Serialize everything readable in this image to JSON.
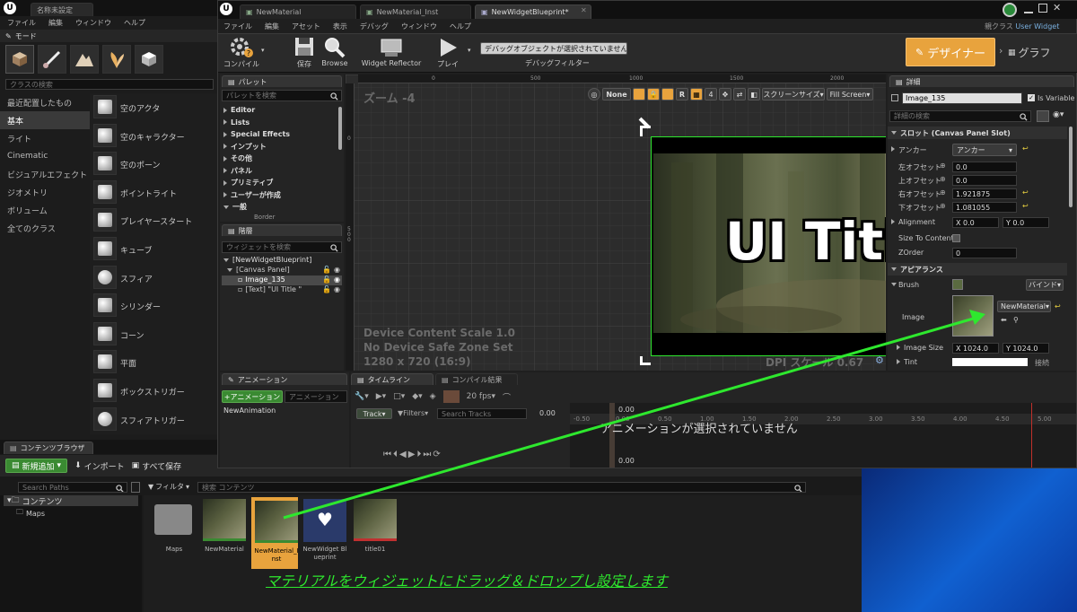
{
  "title_tab": "名称未設定",
  "menu_left": [
    "ファイル",
    "編集",
    "ウィンドウ",
    "ヘルプ"
  ],
  "modes_tab": "モード",
  "class_search_placeholder": "クラスの検索",
  "categories": [
    "最近配置したもの",
    "基本",
    "ライト",
    "Cinematic",
    "ビジュアルエフェクト",
    "ジオメトリ",
    "ボリューム",
    "全てのクラス"
  ],
  "actors": [
    "空のアクタ",
    "空のキャラクター",
    "空のポーン",
    "ポイントライト",
    "プレイヤースタート",
    "キューブ",
    "スフィア",
    "シリンダー",
    "コーン",
    "平面",
    "ボックストリガー",
    "スフィアトリガー"
  ],
  "editor_tabs": [
    "NewMaterial",
    "NewMaterial_Inst",
    "NewWidgetBlueprint*"
  ],
  "parent_class_label": "親クラス",
  "parent_class": "User Widget",
  "menu_editor": [
    "ファイル",
    "編集",
    "アセット",
    "表示",
    "デバッグ",
    "ウィンドウ",
    "ヘルプ"
  ],
  "toolbar": {
    "compile": "コンパイル",
    "save": "保存",
    "browse": "Browse",
    "reflector": "Widget Reflector",
    "play": "プレイ",
    "debug_dropdown": "デバッグオブジェクトが選択されていません",
    "debug_filter": "デバッグフィルター",
    "designer": "デザイナー",
    "graph": "グラフ"
  },
  "palette": {
    "tab": "パレット",
    "search_placeholder": "パレットを検索",
    "items": [
      "Editor",
      "Lists",
      "Special Effects",
      "インプット",
      "その他",
      "パネル",
      "プリミティブ",
      "ユーザーが作成",
      "一般"
    ],
    "sub_item": "Border"
  },
  "hierarchy": {
    "tab": "階層",
    "search_placeholder": "ウィジェットを検索",
    "items": [
      "[NewWidgetBlueprint]",
      "[Canvas Panel]",
      "Image_135",
      "[Text] \"UI Title \""
    ]
  },
  "viewport": {
    "zoom": "ズーム -4",
    "ruler": [
      "0",
      "500",
      "1000",
      "1500",
      "2000"
    ],
    "ruler_v": [
      "0",
      "5 0 0"
    ],
    "none_label": "None",
    "r_label": "R",
    "four_label": "4",
    "screen_size": "スクリーンサイズ",
    "fill_screen": "Fill Screen",
    "ui_title": "UI Title",
    "info1": "Device Content Scale 1.0",
    "info2": "No Device Safe Zone Set",
    "info3": "1280 x 720 (16:9)",
    "dpi": "DPI スケール 0.67"
  },
  "details": {
    "tab": "詳細",
    "name": "Image_135",
    "is_variable": "Is Variable",
    "search_placeholder": "詳細の検索",
    "slot_section": "スロット (Canvas Panel Slot)",
    "anchor_label": "アンカー",
    "anchor_value": "アンカー",
    "offsets": [
      {
        "label": "左オフセット",
        "value": "0.0"
      },
      {
        "label": "上オフセット",
        "value": "0.0"
      },
      {
        "label": "右オフセット",
        "value": "1.921875"
      },
      {
        "label": "下オフセット",
        "value": "1.081055"
      }
    ],
    "alignment_label": "Alignment",
    "align_x": "X  0.0",
    "align_y": "Y  0.0",
    "size_to_content": "Size To Content",
    "zorder_label": "ZOrder",
    "zorder_value": "0",
    "appearance_section": "アピアランス",
    "brush_label": "Brush",
    "bind_label": "バインド",
    "image_label": "Image",
    "image_value": "NewMaterial",
    "image_size_label": "Image Size",
    "size_x": "X  1024.0",
    "size_y": "Y  1024.0",
    "tint_label": "Tint",
    "tint_extra": "接続"
  },
  "animation": {
    "tab": "アニメーション",
    "add_button": "+アニメーション",
    "search_placeholder": "アニメーション",
    "item": "NewAnimation"
  },
  "timeline": {
    "tab": "タイムライン",
    "compile_tab": "コンパイル結果",
    "fps": "20 fps",
    "track": "Track",
    "filters": "Filters",
    "search_placeholder": "Search Tracks",
    "time": "0.00",
    "ticks": [
      "-0.50",
      "0.00",
      "0.50",
      "1.00",
      "1.50",
      "2.00",
      "2.50",
      "3.00",
      "3.50",
      "4.00",
      "4.50",
      "5.00"
    ],
    "no_anim": "アニメーションが選択されていません",
    "bottom_time": "0.00"
  },
  "content_browser": {
    "tab": "コンテンツブラウザ",
    "add_new": "新規追加",
    "import": "インポート",
    "save_all": "すべて保存",
    "search_paths": "Search Paths",
    "filter": "フィルタ",
    "search_content": "検索 コンテンツ",
    "folders": [
      "コンテンツ",
      "Maps"
    ],
    "assets": [
      {
        "label": "Maps",
        "kind": "folder"
      },
      {
        "label": "NewMaterial",
        "kind": "material"
      },
      {
        "label": "NewMaterial_Inst",
        "kind": "instance"
      },
      {
        "label": "NewWidget Blueprint",
        "kind": "widget"
      },
      {
        "label": "title01",
        "kind": "texture"
      }
    ]
  },
  "annotation": "マテリアルをウィジェットにドラッグ＆ドロップし設定します",
  "colors": {
    "accent": "#e8a33d",
    "selection_green": "#2ee82e",
    "annotation": "#2ee82e",
    "highlight_orange": "#f5a623"
  }
}
